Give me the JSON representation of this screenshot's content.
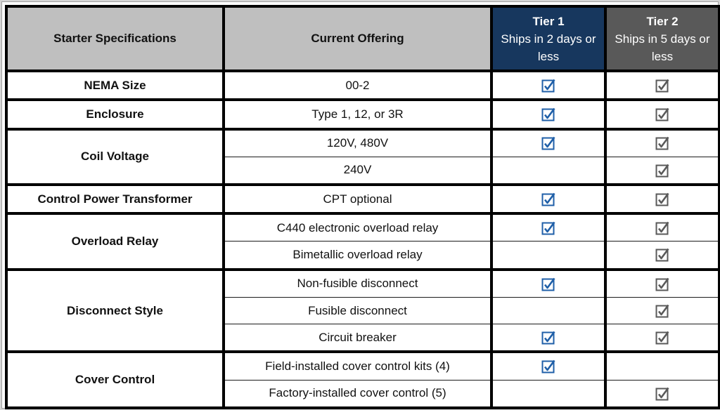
{
  "header": {
    "spec_label": "Starter Specifications",
    "offering_label": "Current Offering",
    "tier1": {
      "title": "Tier 1",
      "subtitle": "Ships in 2 days or less",
      "color": "#17375e"
    },
    "tier2": {
      "title": "Tier 2",
      "subtitle": "Ships in 5 days or less",
      "color": "#595959"
    }
  },
  "colors": {
    "tier1_check": "#1f5fa8",
    "tier2_check": "#595959",
    "header_bg": "#bfbfbf"
  },
  "groups": [
    {
      "spec": "NEMA Size",
      "rows": [
        {
          "offering": "00-2",
          "tier1": true,
          "tier2": true
        }
      ]
    },
    {
      "spec": "Enclosure",
      "rows": [
        {
          "offering": "Type 1, 12, or 3R",
          "tier1": true,
          "tier2": true
        }
      ]
    },
    {
      "spec": "Coil Voltage",
      "rows": [
        {
          "offering": "120V, 480V",
          "tier1": true,
          "tier2": true
        },
        {
          "offering": "240V",
          "tier1": false,
          "tier2": true
        }
      ]
    },
    {
      "spec": "Control Power Transformer",
      "rows": [
        {
          "offering": "CPT optional",
          "tier1": true,
          "tier2": true
        }
      ]
    },
    {
      "spec": "Overload Relay",
      "rows": [
        {
          "offering": "C440 electronic overload relay",
          "tier1": true,
          "tier2": true
        },
        {
          "offering": "Bimetallic overload relay",
          "tier1": false,
          "tier2": true
        }
      ]
    },
    {
      "spec": "Disconnect Style",
      "rows": [
        {
          "offering": "Non-fusible disconnect",
          "tier1": true,
          "tier2": true
        },
        {
          "offering": "Fusible disconnect",
          "tier1": false,
          "tier2": true
        },
        {
          "offering": "Circuit breaker",
          "tier1": true,
          "tier2": true
        }
      ]
    },
    {
      "spec": "Cover Control",
      "rows": [
        {
          "offering": "Field-installed cover control kits (4)",
          "tier1": true,
          "tier2": false
        },
        {
          "offering": "Factory-installed cover control (5)",
          "tier1": false,
          "tier2": true
        }
      ]
    }
  ]
}
